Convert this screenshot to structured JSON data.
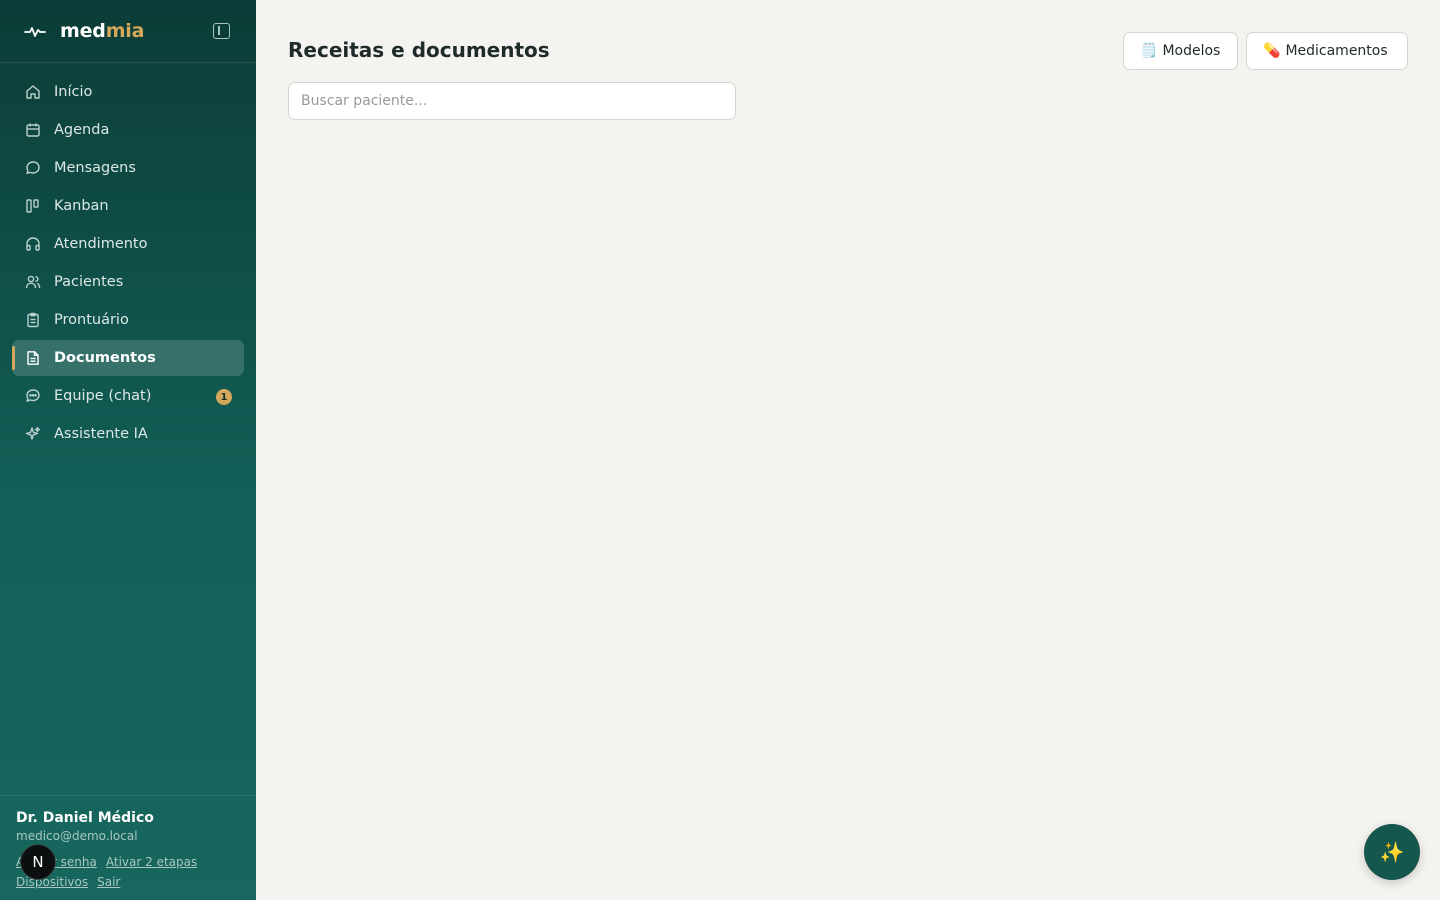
{
  "brand": {
    "part1": "med",
    "part2": "mia"
  },
  "sidebar": {
    "items": [
      {
        "label": "Início",
        "icon": "home-icon"
      },
      {
        "label": "Agenda",
        "icon": "calendar-icon"
      },
      {
        "label": "Mensagens",
        "icon": "message-icon"
      },
      {
        "label": "Kanban",
        "icon": "kanban-icon"
      },
      {
        "label": "Atendimento",
        "icon": "headphones-icon"
      },
      {
        "label": "Pacientes",
        "icon": "users-icon"
      },
      {
        "label": "Prontuário",
        "icon": "clipboard-icon"
      },
      {
        "label": "Documentos",
        "icon": "document-icon",
        "active": true
      },
      {
        "label": "Equipe (chat)",
        "icon": "chat-icon",
        "badge": "1"
      },
      {
        "label": "Assistente IA",
        "icon": "sparkles-icon"
      }
    ]
  },
  "user": {
    "name": "Dr. Daniel Médico",
    "email": "medico@demo.local",
    "links": {
      "password": "Alterar senha",
      "two_factor": "Ativar 2 etapas",
      "devices": "Dispositivos",
      "logout": "Sair"
    },
    "avatar_letter": "N"
  },
  "header": {
    "title": "Receitas e documentos",
    "modelos_label": "Modelos",
    "modelos_emoji": "🗒️",
    "medicamentos_label": "Medicamentos",
    "medicamentos_emoji": "💊"
  },
  "search": {
    "placeholder": "Buscar paciente..."
  },
  "fab": {
    "emoji": "✨"
  },
  "colors": {
    "accent": "#d4a85a",
    "sidebar_top": "#0c3c37",
    "sidebar_bottom": "#17675f",
    "background": "#f5f3ef",
    "fab": "#15564f"
  }
}
